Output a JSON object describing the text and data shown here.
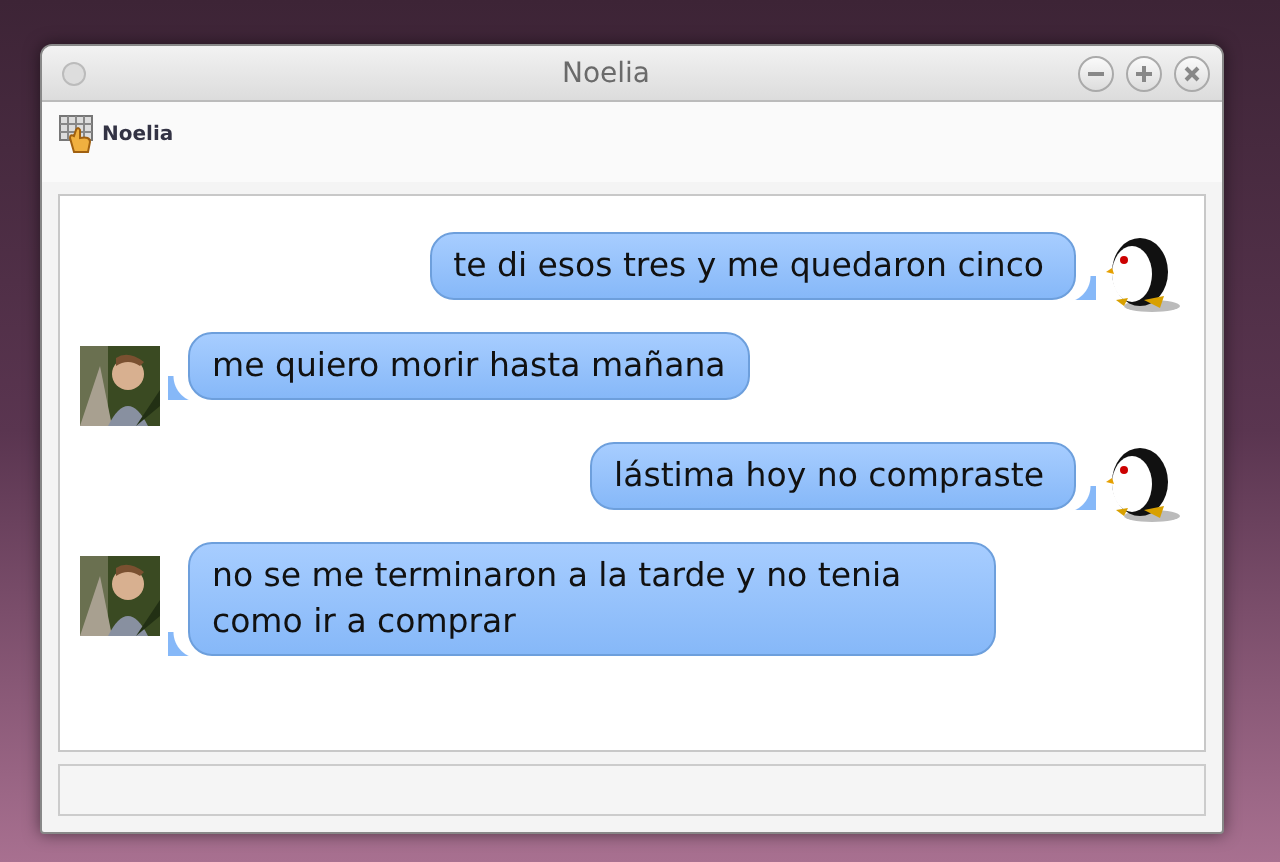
{
  "window": {
    "title": "Noelia"
  },
  "toolbar": {
    "contact": "Noelia"
  },
  "messages": [
    {
      "kind": "outgoing",
      "text": "te di esos tres y me quedaron cinco"
    },
    {
      "kind": "incoming",
      "text": "me quiero morir hasta mañana"
    },
    {
      "kind": "outgoing",
      "text": "lástima hoy no compraste"
    },
    {
      "kind": "incoming",
      "text": "no se me terminaron a la tarde y no tenia como ir a comprar"
    }
  ]
}
